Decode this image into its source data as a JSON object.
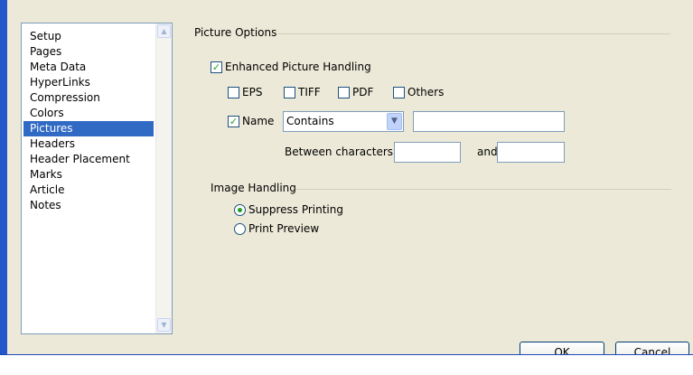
{
  "sidebar": {
    "items": [
      {
        "label": "Setup"
      },
      {
        "label": "Pages"
      },
      {
        "label": "Meta Data"
      },
      {
        "label": "HyperLinks"
      },
      {
        "label": "Compression"
      },
      {
        "label": "Colors"
      },
      {
        "label": "Pictures"
      },
      {
        "label": "Headers"
      },
      {
        "label": "Header Placement"
      },
      {
        "label": "Marks"
      },
      {
        "label": "Article"
      },
      {
        "label": "Notes"
      }
    ],
    "selected": "Pictures"
  },
  "picture_options": {
    "title": "Picture Options",
    "enhanced_label": "Enhanced Picture Handling",
    "enhanced_checked": true,
    "eps_label": "EPS",
    "tiff_label": "TIFF",
    "pdf_label": "PDF",
    "others_label": "Others",
    "name_label": "Name",
    "name_checked": true,
    "match_value": "Contains",
    "name_value": "",
    "between_label": "Between characters",
    "between_from": "",
    "and_label": "and",
    "between_to": ""
  },
  "image_handling": {
    "title": "Image Handling",
    "suppress_label": "Suppress Printing",
    "preview_label": "Print Preview",
    "selected": "Suppress Printing"
  },
  "buttons": {
    "ok": "OK",
    "cancel": "Cancel"
  },
  "colors": {
    "selection": "#316ac5",
    "check": "#21a121",
    "frame_blue": "#2356c9",
    "dialog_bg": "#ece9d8"
  },
  "icons": {
    "scroll_up": "chevron-up-icon",
    "scroll_down": "chevron-down-icon",
    "combo": "chevron-down-icon",
    "check": "checkmark-icon"
  }
}
